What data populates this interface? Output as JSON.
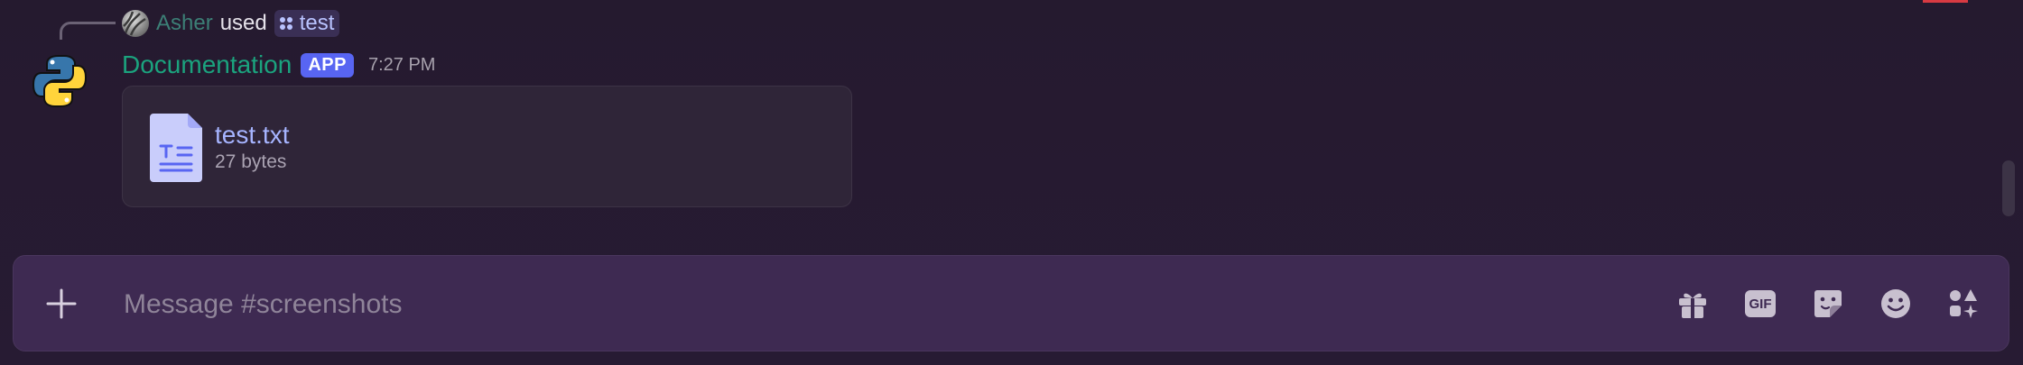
{
  "reply": {
    "username": "Asher",
    "action": "used",
    "command": "test"
  },
  "message": {
    "author": "Documentation",
    "badge": "APP",
    "time": "7:27 PM",
    "attachment": {
      "file_name": "test.txt",
      "file_size": "27 bytes"
    }
  },
  "composer": {
    "placeholder": "Message #screenshots",
    "gif_label": "GIF"
  },
  "icons": {
    "add": "plus-icon",
    "gift": "gift-icon",
    "gif": "gif-icon",
    "sticker": "sticker-icon",
    "emoji": "emoji-icon",
    "apps": "apps-icon",
    "file": "text-file-icon",
    "avatar": "python-logo"
  },
  "colors": {
    "author": "#1ba37e",
    "reply_user": "#3c7f76",
    "badge": "#5865f2",
    "link": "#a6b4ff",
    "composer_bg": "#3e2a52"
  }
}
